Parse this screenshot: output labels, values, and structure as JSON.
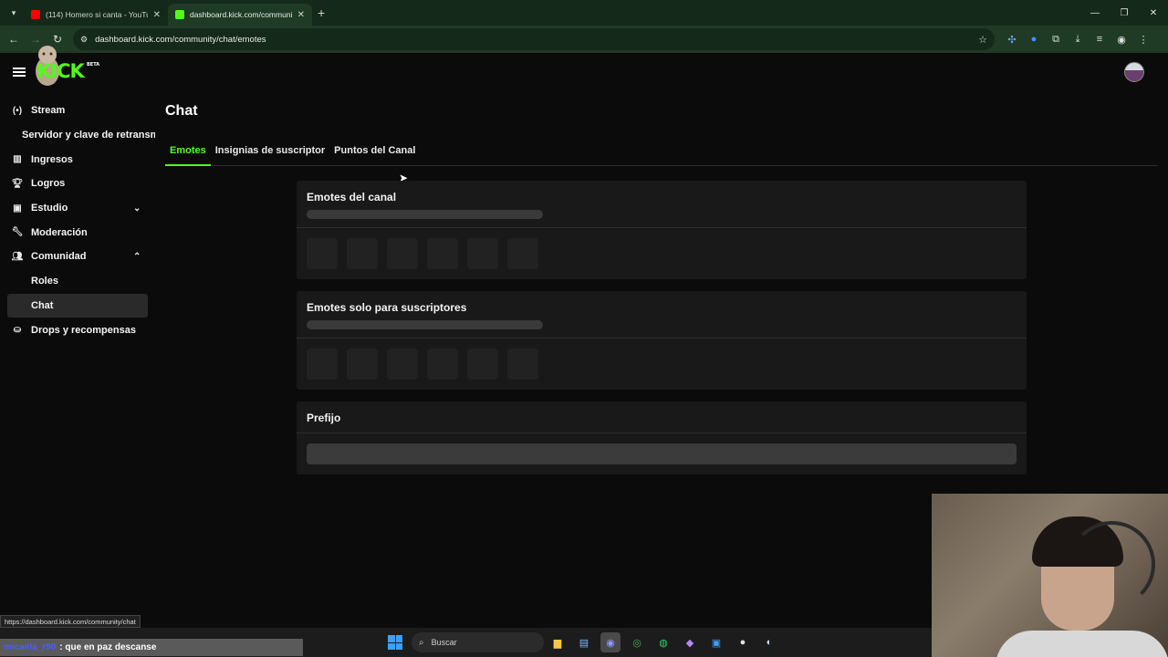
{
  "browser": {
    "tabs": [
      {
        "title": "(114) Homero si canta - YouTub",
        "favicon_color": "#ff0000",
        "active": false
      },
      {
        "title": "dashboard.kick.com/communit",
        "favicon_color": "#53fc18",
        "active": true
      }
    ],
    "url": "dashboard.kick.com/community/chat/emotes",
    "status_url": "https://dashboard.kick.com/community/chat"
  },
  "app": {
    "logo_text": "KICK",
    "logo_badge": "BETA",
    "accent_color": "#53fc18"
  },
  "sidebar": {
    "items": [
      {
        "label": "Stream",
        "icon": "broadcast-icon"
      },
      {
        "label": "Servidor y clave de retransmisión",
        "icon": ""
      },
      {
        "label": "Ingresos",
        "icon": "chart-icon"
      },
      {
        "label": "Logros",
        "icon": "trophy-icon"
      },
      {
        "label": "Estudio",
        "icon": "studio-icon",
        "expand": "chevron-down-icon"
      },
      {
        "label": "Moderación",
        "icon": "wrench-icon"
      },
      {
        "label": "Comunidad",
        "icon": "community-icon",
        "expand": "chevron-up-icon"
      },
      {
        "label": "Roles",
        "icon": ""
      },
      {
        "label": "Chat",
        "icon": "",
        "selected": true
      },
      {
        "label": "Drops y recompensas",
        "icon": "gift-icon"
      }
    ]
  },
  "main": {
    "title": "Chat",
    "tabs": [
      {
        "label": "Emotes",
        "active": true
      },
      {
        "label": "Insignias de suscriptor",
        "active": false
      },
      {
        "label": "Puntos del Canal",
        "active": false
      }
    ],
    "cards": {
      "channel_emotes_title": "Emotes del canal",
      "sub_emotes_title": "Emotes solo para suscriptores",
      "prefix_title": "Prefijo"
    }
  },
  "taskbar": {
    "chat_user": "micaela_r90",
    "chat_message": ": que en paz descanse",
    "search_placeholder": "Buscar"
  }
}
